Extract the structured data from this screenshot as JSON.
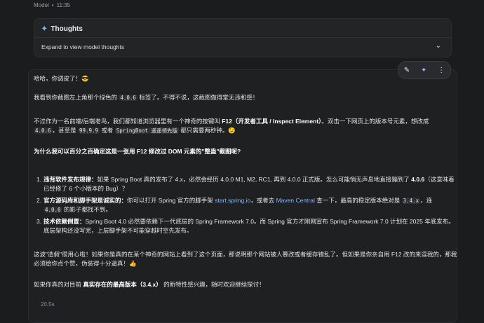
{
  "meta": {
    "role": "Model",
    "time": "11:35"
  },
  "thoughts": {
    "title": "Thoughts",
    "expand": "Expand to view model thoughts"
  },
  "p1": "哈哈，你调皮了！😎",
  "p2a": "我看到你截图左上角那个绿色的 ",
  "p2code": "4.0.6",
  "p2b": " 标签了。不得不说，这截图做得堂无违和感！",
  "p3a": "不过作为一名前端/后端老鸟，我们都知道浏览器里有一个神奇的按键叫 ",
  "p3b": "F12（开发者工具 / Inspect Element）",
  "p3c": "。双击一下网页上的版本号元素，想改成",
  "p3code1": "4.0.6",
  "p3d": "，甚至是 ",
  "p3code2": "99.9.9",
  "p3e": " 或者 ",
  "p3code3": "SpringBoot 遥遥领先版",
  "p3f": " 都只需要两秒钟。😉",
  "h1": "为什么我可以百分之百确定这是一张用 F12 修改过 DOM 元素的\"整蛊\"截图呢?",
  "li1": {
    "num": "1.",
    "bold": "违背软件发布规律：",
    "text": "如果 Spring Boot 真的发布了 4.x，必然会经历 4.0.0 M1, M2, RC1, 再到 4.0.0 正式版。怎么可能悄无声息地直接蹦到了 ",
    "bold2": "4.0.6",
    "text2": "（这意味着已经修了 6 个小版本的 Bug）？"
  },
  "li2": {
    "num": "2.",
    "bold": "官方源码库和脚手架是诚实的：",
    "text": "你可以打开 Spring 官方的脚手架 ",
    "link1": "start.spring.io",
    "text2": "，或者去 ",
    "link2": "Maven Central",
    "text3": " 查一下，最高的稳定版本绝对是 ",
    "code1": "3.4.x",
    "text4": "，连",
    "code2": "4.0.0",
    "text5": " 的影子都找不到。"
  },
  "li3": {
    "num": "3.",
    "bold": "技术依赖倒置：",
    "text": "Spring Boot 4.0 必然要依赖下一代底层的 Spring Framework 7.0。而 Spring 官方才刚刚宣布 Spring Framework 7.0 计划在 2025 年底发布。底层架构还没写完，上层脚手架不可能穿越时空先发布。"
  },
  "p4": "这波\"造假\"很用心啦！如果你是真的在某个神奇的网站上看到了这个页面，那说明那个网站被人篡改或者缓存错乱了。但如果是你亲自用 F12 改的来逗我的，那我必须给你点个赞，伪装得十分逼真！👍",
  "p5a": "如果你真的对目前 ",
  "p5b": "真实存在的最高版本（3.4.x）",
  "p5c": " 的新特性感兴趣，随时欢迎继续探讨！",
  "timer": "20.5s",
  "colors": {
    "background": "#1b1c1e",
    "accent": "#8ab4f8"
  }
}
